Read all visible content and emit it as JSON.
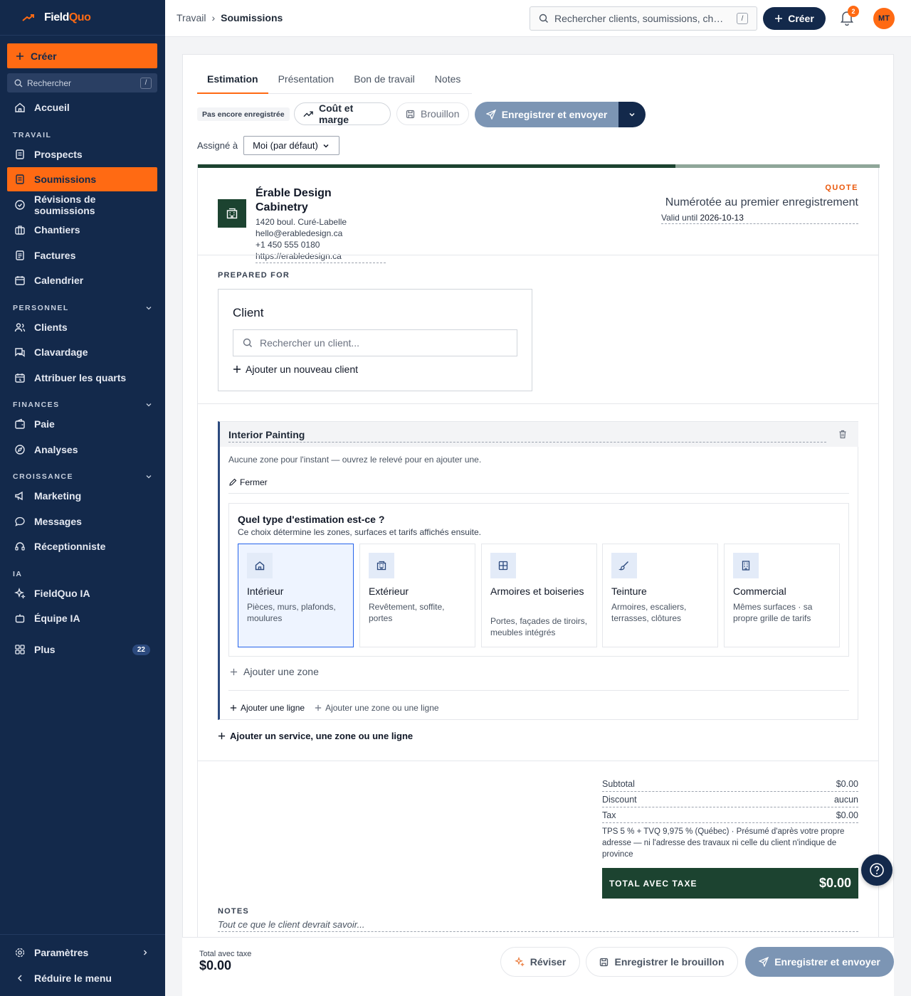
{
  "brand": {
    "name_part1": "Field",
    "name_part2": "Quo",
    "accent_color": "#ff6a13",
    "navy_color": "#13294b"
  },
  "sidebar": {
    "create_label": "Créer",
    "search_placeholder": "Rechercher",
    "search_shortcut": "/",
    "home": "Accueil",
    "sections": {
      "travail": "TRAVAIL",
      "personnel": "PERSONNEL",
      "finances": "FINANCES",
      "croissance": "CROISSANCE",
      "ia": "IA"
    },
    "items": {
      "prospects": "Prospects",
      "soumissions": "Soumissions",
      "revisions": "Révisions de soumissions",
      "chantiers": "Chantiers",
      "factures": "Factures",
      "calendrier": "Calendrier",
      "clients": "Clients",
      "clavardage": "Clavardage",
      "quarts": "Attribuer les quarts",
      "paie": "Paie",
      "analyses": "Analyses",
      "marketing": "Marketing",
      "messages": "Messages",
      "receptionniste": "Réceptionniste",
      "fieldquo_ia": "FieldQuo IA",
      "equipe_ia": "Équipe IA",
      "plus": "Plus",
      "plus_badge": "22"
    },
    "settings": "Paramètres",
    "collapse": "Réduire le menu"
  },
  "topbar": {
    "breadcrumb_parent": "Travail",
    "breadcrumb_sep": "›",
    "breadcrumb_current": "Soumissions",
    "search_placeholder": "Rechercher clients, soumissions, ch…",
    "search_shortcut": "/",
    "create_label": "Créer",
    "notifications_count": "2",
    "avatar_initials": "MT"
  },
  "tabs": [
    "Estimation",
    "Présentation",
    "Bon de travail",
    "Notes"
  ],
  "toolbar": {
    "status_badge": "Pas encore enregistrée",
    "cost_margin": "Coût et marge",
    "draft": "Brouillon",
    "save_send": "Enregistrer et envoyer",
    "assigned_label": "Assigné à",
    "assigned_value": "Moi (par défaut)"
  },
  "quote": {
    "progress_fraction": 0.7,
    "company_name": "Érable Design Cabinetry",
    "address": "1420 boul. Curé-Labelle",
    "email": "hello@erabledesign.ca",
    "phone": "+1 450 555 0180",
    "website": "https://erabledesign.ca",
    "doc_label": "QUOTE",
    "numbering": "Numérotée au premier enregistrement",
    "valid_label": "Valid until",
    "valid_date": "2026-10-13",
    "prepared_for": "PREPARED FOR",
    "client_title": "Client",
    "client_search_placeholder": "Rechercher un client...",
    "add_client": "Ajouter un nouveau client"
  },
  "service": {
    "title": "Interior Painting",
    "empty_note": "Aucune zone pour l'instant — ouvrez le relevé pour en ajouter une.",
    "close_label": "Fermer",
    "question": "Quel type d'estimation est-ce ?",
    "question_sub": "Ce choix détermine les zones, surfaces et tarifs affichés ensuite.",
    "types": [
      {
        "name": "Intérieur",
        "desc": "Pièces, murs, plafonds, moulures",
        "icon": "house-icon",
        "selected": true
      },
      {
        "name": "Extérieur",
        "desc": "Revêtement, soffite, portes",
        "icon": "building-icon",
        "selected": false
      },
      {
        "name": "Armoires et boiseries",
        "desc": "Portes, façades de tiroirs, meubles intégrés",
        "icon": "cabinet-grid-icon",
        "selected": false
      },
      {
        "name": "Teinture",
        "desc": "Armoires, escaliers, terrasses, clôtures",
        "icon": "brush-icon",
        "selected": false
      },
      {
        "name": "Commercial",
        "desc": "Mêmes surfaces · sa propre grille de tarifs",
        "icon": "office-building-icon",
        "selected": false
      }
    ],
    "add_zone": "Ajouter une zone",
    "add_line": "Ajouter une ligne",
    "add_zone_or_line": "Ajouter une zone ou une ligne"
  },
  "add_service": "Ajouter un service, une zone ou une ligne",
  "totals": {
    "subtotal_label": "Subtotal",
    "subtotal_value": "$0.00",
    "discount_label": "Discount",
    "discount_value": "aucun",
    "tax_label": "Tax",
    "tax_value": "$0.00",
    "tax_note": "TPS 5 % + TVQ 9,975 % (Québec) · Présumé d'après votre propre adresse — ni l'adresse des travaux ni celle du client n'indique de province",
    "grand_label": "TOTAL AVEC TAXE",
    "grand_value": "$0.00"
  },
  "notes": {
    "label": "NOTES",
    "placeholder": "Tout ce que le client devrait savoir..."
  },
  "bottombar": {
    "total_label": "Total avec taxe",
    "total_value": "$0.00",
    "revise": "Réviser",
    "save_draft": "Enregistrer le brouillon",
    "save_send": "Enregistrer et envoyer"
  }
}
